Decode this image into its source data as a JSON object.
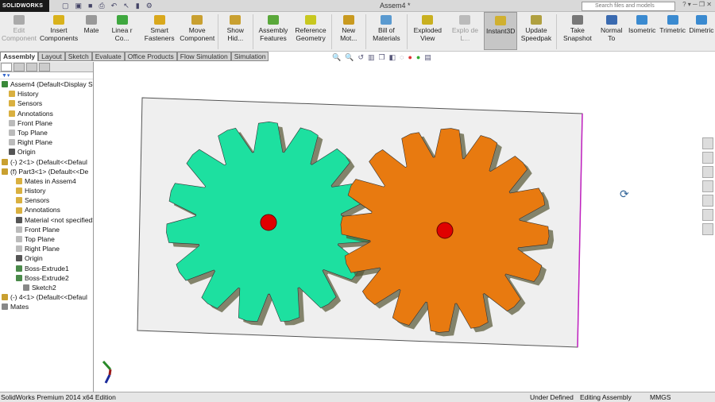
{
  "app": {
    "logo": "SOLIDWORKS",
    "document_title": "Assem4 *",
    "search_placeholder": "Search files and models"
  },
  "ribbon": [
    {
      "label": "Edit Component",
      "disabled": true,
      "color": "#aaaaaa"
    },
    {
      "label": "Insert Components",
      "color": "#d9b21c"
    },
    {
      "label": "Mate",
      "color": "#999999"
    },
    {
      "label": "Linea r Co...",
      "color": "#3fa83f"
    },
    {
      "label": "Smart Fasteners",
      "color": "#d9a81c"
    },
    {
      "label": "Move Component",
      "color": "#c9a030"
    },
    {
      "sep": true
    },
    {
      "label": "Show Hid...",
      "color": "#c9a030"
    },
    {
      "sep": true
    },
    {
      "label": "Assembly Features",
      "color": "#5aa83a"
    },
    {
      "label": "Reference Geometry",
      "color": "#c8c820"
    },
    {
      "sep": true
    },
    {
      "label": "New Mot...",
      "color": "#c99a20"
    },
    {
      "sep": true
    },
    {
      "label": "Bill of Materials",
      "color": "#5a9ad0"
    },
    {
      "sep": true
    },
    {
      "label": "Exploded View",
      "color": "#c9b020"
    },
    {
      "label": "Explo de L...",
      "disabled": true,
      "color": "#bbbbbb"
    },
    {
      "label": "Instant3D",
      "active": true,
      "color": "#d0b030"
    },
    {
      "label": "Update Speedpak",
      "color": "#b0a040"
    },
    {
      "sep": true
    },
    {
      "label": "Take Snapshot",
      "color": "#777777"
    },
    {
      "label": "Normal To",
      "color": "#3a6ab0"
    },
    {
      "label": "Isometric",
      "color": "#3a8ad0"
    },
    {
      "label": "Trimetric",
      "color": "#3a8ad0"
    },
    {
      "label": "Dimetric",
      "color": "#3a8ad0"
    }
  ],
  "tabs": [
    "Assembly",
    "Layout",
    "Sketch",
    "Evaluate",
    "Office Products",
    "Flow Simulation",
    "Simulation"
  ],
  "tree": [
    {
      "label": "Assem4  (Default<Display St",
      "indent": 0,
      "color": "#3a8a3a"
    },
    {
      "label": "History",
      "indent": 1,
      "color": "#d9b040"
    },
    {
      "label": "Sensors",
      "indent": 1,
      "color": "#d9b040"
    },
    {
      "label": "Annotations",
      "indent": 1,
      "color": "#d9b040"
    },
    {
      "label": "Front Plane",
      "indent": 1,
      "color": "#bbbbbb"
    },
    {
      "label": "Top Plane",
      "indent": 1,
      "color": "#bbbbbb"
    },
    {
      "label": "Right Plane",
      "indent": 1,
      "color": "#bbbbbb"
    },
    {
      "label": "Origin",
      "indent": 1,
      "color": "#555555"
    },
    {
      "label": "(-) 2<1> (Default<<Defaul",
      "indent": 0,
      "color": "#c9a030"
    },
    {
      "label": "(f) Part3<1> (Default<<De",
      "indent": 0,
      "color": "#c9a030"
    },
    {
      "label": "Mates in Assem4",
      "indent": 2,
      "color": "#d9b040"
    },
    {
      "label": "History",
      "indent": 2,
      "color": "#d9b040"
    },
    {
      "label": "Sensors",
      "indent": 2,
      "color": "#d9b040"
    },
    {
      "label": "Annotations",
      "indent": 2,
      "color": "#d9b040"
    },
    {
      "label": "Material <not specified>",
      "indent": 2,
      "color": "#555555"
    },
    {
      "label": "Front Plane",
      "indent": 2,
      "color": "#bbbbbb"
    },
    {
      "label": "Top Plane",
      "indent": 2,
      "color": "#bbbbbb"
    },
    {
      "label": "Right Plane",
      "indent": 2,
      "color": "#bbbbbb"
    },
    {
      "label": "Origin",
      "indent": 2,
      "color": "#555555"
    },
    {
      "label": "Boss-Extrude1",
      "indent": 2,
      "color": "#4a8a4a"
    },
    {
      "label": "Boss-Extrude2",
      "indent": 2,
      "color": "#4a8a4a"
    },
    {
      "label": "Sketch2",
      "indent": 3,
      "color": "#888888"
    },
    {
      "label": "(-) 4<1> (Default<<Defaul",
      "indent": 0,
      "color": "#c9a030"
    },
    {
      "label": "Mates",
      "indent": 0,
      "color": "#888888"
    }
  ],
  "gears": [
    {
      "name": "green-gear",
      "teeth": 15,
      "color": "#1de0a0",
      "hub": "#e00000"
    },
    {
      "name": "orange-gear",
      "teeth": 16,
      "color": "#e87a10",
      "hub": "#e00000"
    }
  ],
  "status": {
    "edition": "SolidWorks Premium 2014 x64 Edition",
    "state": "Under Defined",
    "mode": "Editing Assembly",
    "units": "MMGS"
  }
}
